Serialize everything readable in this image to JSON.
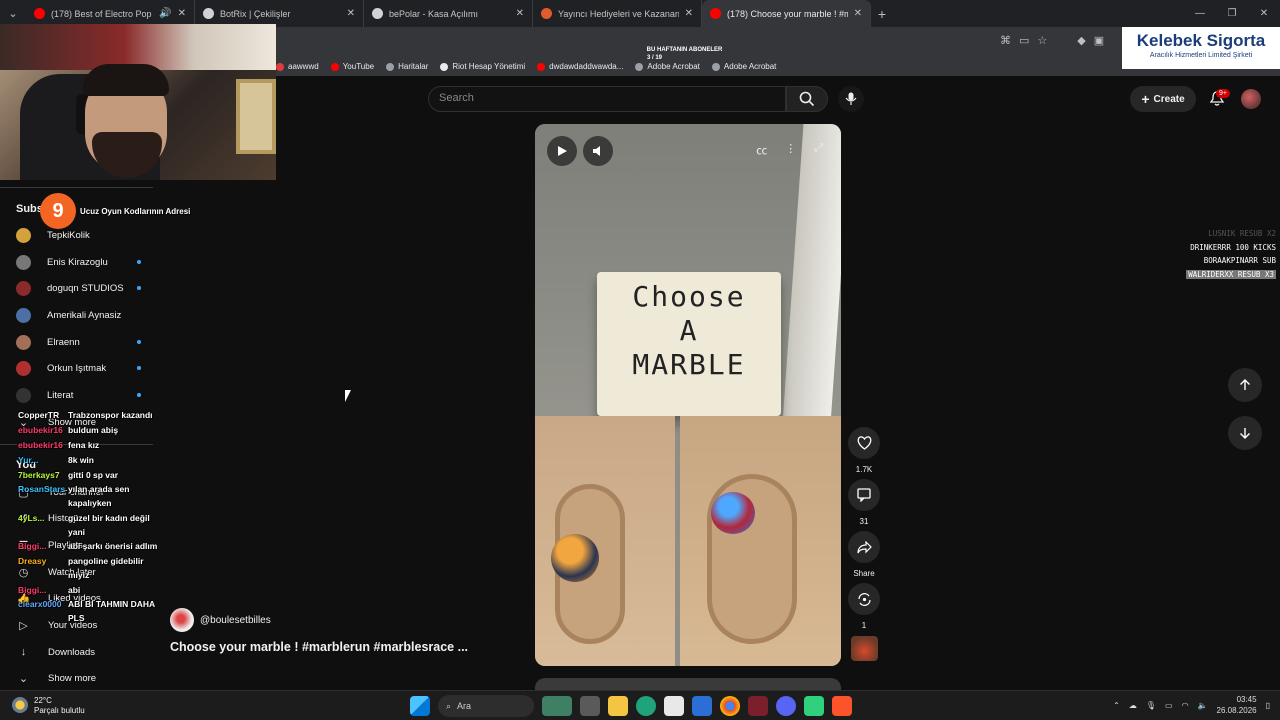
{
  "browser": {
    "tabs": [
      {
        "title": "(178) Best of Electro Pop 20",
        "favicon_color": "#ff0000",
        "audio": true
      },
      {
        "title": "BotRix | Çekilişler",
        "favicon_color": "#cfd3d8",
        "audio": false
      },
      {
        "title": "bePolar - Kasa Açılımı",
        "favicon_color": "#cfd3d8",
        "audio": false
      },
      {
        "title": "Yayıncı Hediyeleri ve Kazananla",
        "favicon_color": "#e25c2b",
        "audio": false
      },
      {
        "title": "(178) Choose your marble ! #m",
        "favicon_color": "#ff0000",
        "audio": false,
        "active": true
      }
    ],
    "bookmarks": [
      "aawwwd",
      "YouTube",
      "Haritalar",
      "Riot Hesap Yönetimi",
      "dwdawdaddwawda...",
      "Adobe Acrobat",
      "Adobe Acrobat"
    ]
  },
  "stream_overlay": {
    "banner_title": "BU HAFTANIN ABONELER",
    "banner_count": "3 / 19",
    "chat_title": "Ucuz Oyun Kodlarının Adresi",
    "chat": [
      {
        "user": "CopperTR",
        "msg": "Trabzonspor kazandı",
        "color": "#ffffff"
      },
      {
        "user": "ebubekir16",
        "msg": "buldum abiş",
        "color": "#ff3b6b"
      },
      {
        "user": "ebubekir16",
        "msg": "fena kız",
        "color": "#ff3b6b"
      },
      {
        "user": "Yur...",
        "msg": "8k win",
        "color": "#39c4ff"
      },
      {
        "user": "7berkays7",
        "msg": "gitti 0 sp var",
        "color": "#b7f542"
      },
      {
        "user": "RosanStars",
        "msg": "yılan arada sen",
        "color": "#39c4ff"
      },
      {
        "user": "",
        "msg": "kapalıyken",
        "color": "#ffffff"
      },
      {
        "user": "4yLs...",
        "msg": "güzel bir kadın değil",
        "color": "#b7f542"
      },
      {
        "user": "",
        "msg": "yani",
        "color": "#ffffff"
      },
      {
        "user": "Biggi...",
        "msg": "abi şarkı önerisi adlım",
        "color": "#ff3b6b"
      },
      {
        "user": "Dreasy",
        "msg": "pangoline gidebilir",
        "color": "#ffb020"
      },
      {
        "user": "",
        "msg": "miyiz",
        "color": "#ffffff"
      },
      {
        "user": "Biggi...",
        "msg": "abi",
        "color": "#ff3b6b"
      },
      {
        "user": "clearx0000",
        "msg": "ABI BI TAHMIN DAHA",
        "color": "#5da8ff"
      },
      {
        "user": "",
        "msg": "PLS",
        "color": "#ffffff"
      }
    ],
    "events": [
      {
        "text": "LUSNIK RESUB X2",
        "style": "faded"
      },
      {
        "text": "DRINKERRR 100 KICKS",
        "style": "normal"
      },
      {
        "text": "BORAAKPINARR SUB",
        "style": "normal"
      },
      {
        "text": "WALRIDERXX RESUB X3",
        "style": "hl"
      }
    ]
  },
  "sponsor": {
    "name": "Kelebek Sigorta",
    "tagline": "Aracılık Hizmetleri Limited Şirketi"
  },
  "youtube": {
    "search_placeholder": "Search",
    "create_label": "Create",
    "notif_badge": "9+",
    "sidebar": {
      "section_title": "Subs",
      "subscriptions": [
        {
          "name": "TepkiKolik",
          "color": "#d4a23a",
          "indicator": false
        },
        {
          "name": "Enis Kirazoglu",
          "color": "#777777",
          "indicator": true
        },
        {
          "name": "doguqn STUDIOS",
          "color": "#8a2a2a",
          "indicator": true
        },
        {
          "name": "Amerikali Aynasiz",
          "color": "#4c6fa6",
          "indicator": false
        },
        {
          "name": "Elraenn",
          "color": "#a26f58",
          "indicator": true
        },
        {
          "name": "Orkun Işıtmak",
          "color": "#b03030",
          "indicator": true
        },
        {
          "name": "Literat",
          "color": "#333333",
          "indicator": true
        }
      ],
      "show_more_1": "Show more",
      "you_label": "You",
      "you_items": [
        {
          "icon": "channel-icon",
          "glyph": "▢",
          "label": "Your channel"
        },
        {
          "icon": "history-icon",
          "glyph": "↺",
          "label": "History"
        },
        {
          "icon": "playlists-icon",
          "glyph": "☰",
          "label": "Playlists"
        },
        {
          "icon": "watch-later-icon",
          "glyph": "◷",
          "label": "Watch later"
        },
        {
          "icon": "liked-icon",
          "glyph": "👍",
          "label": "Liked videos"
        },
        {
          "icon": "your-videos-icon",
          "glyph": "▷",
          "label": "Your videos"
        },
        {
          "icon": "downloads-icon",
          "glyph": "↓",
          "label": "Downloads"
        },
        {
          "icon": "chevron-down-icon",
          "glyph": "⌄",
          "label": "Show more"
        }
      ]
    },
    "short": {
      "board_text": [
        "Choose",
        "A",
        "MARBLE"
      ],
      "channel": "@boulesetbilles",
      "title": "Choose your marble ! #marblerun #marblesrace ...",
      "likes": "1.7K",
      "comments": "31",
      "share_label": "Share",
      "remix_count": "1"
    }
  },
  "taskbar": {
    "temperature": "22°C",
    "weather": "Parçalı bulutlu",
    "search_label": "Ara",
    "time": "03:45",
    "date": "26.08.2026"
  }
}
